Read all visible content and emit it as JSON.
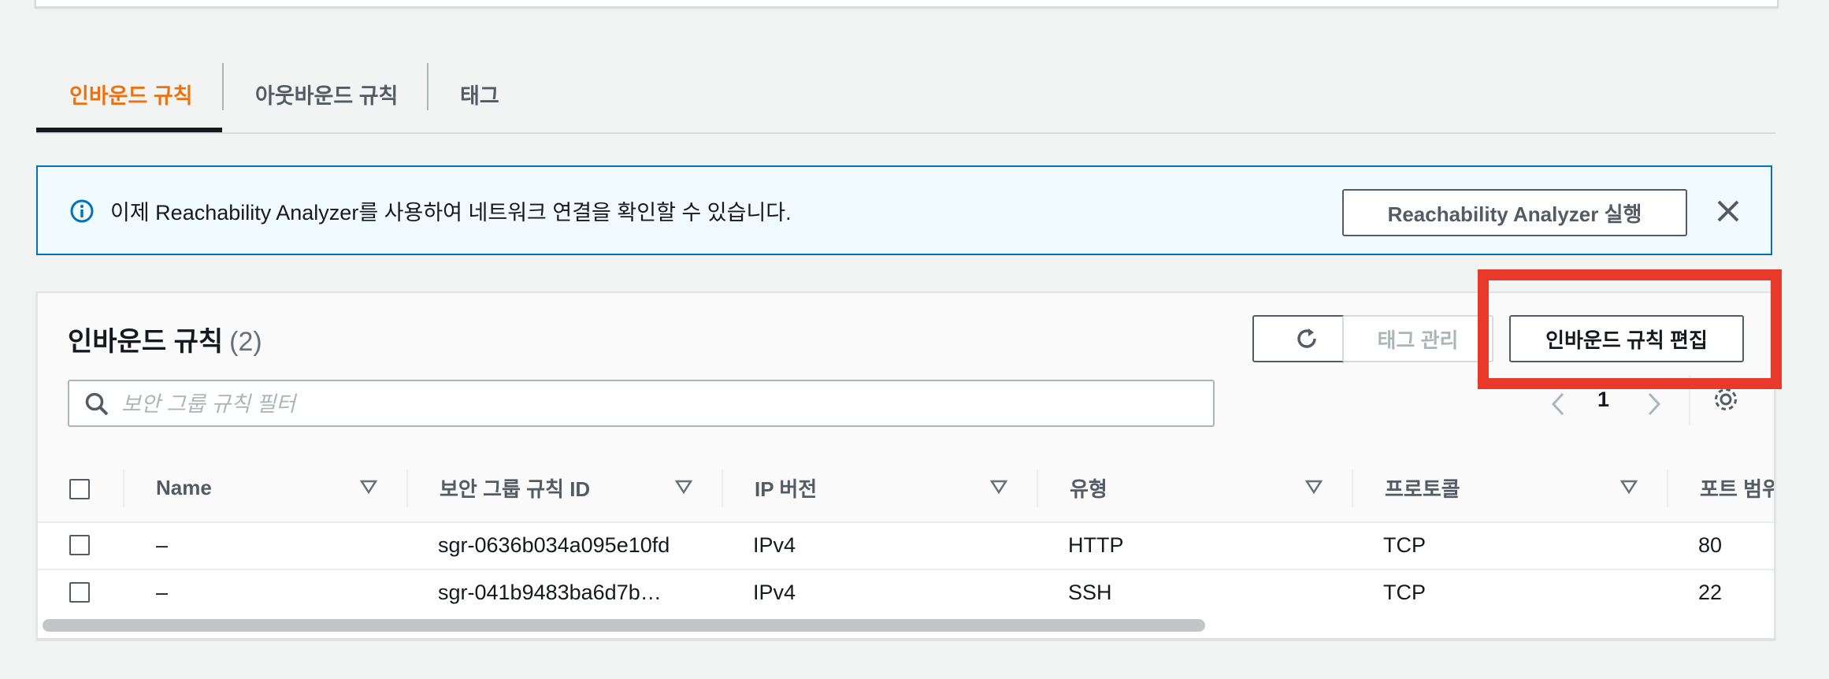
{
  "tabs": [
    {
      "label": "인바운드 규칙",
      "active": true
    },
    {
      "label": "아웃바운드 규칙",
      "active": false
    },
    {
      "label": "태그",
      "active": false
    }
  ],
  "alert": {
    "message": "이제 Reachability Analyzer를 사용하여 네트워크 연결을 확인할 수 있습니다.",
    "button_label": "Reachability Analyzer 실행",
    "icon": "info-icon"
  },
  "panel": {
    "title": "인바운드 규칙",
    "count": "(2)",
    "tag_button_label": "태그 관리",
    "edit_button_label": "인바운드 규칙 편집",
    "search_placeholder": "보안 그룹 규칙 필터",
    "page_number": "1"
  },
  "table": {
    "columns": [
      "Name",
      "보안 그룹 규칙 ID",
      "IP 버전",
      "유형",
      "프로토콜",
      "포트 범위"
    ],
    "rows": [
      {
        "name": "–",
        "rule_id": "sgr-0636b034a095e10fd",
        "ip_version": "IPv4",
        "type": "HTTP",
        "protocol": "TCP",
        "port": "80"
      },
      {
        "name": "–",
        "rule_id": "sgr-041b9483ba6d7b…",
        "ip_version": "IPv4",
        "type": "SSH",
        "protocol": "TCP",
        "port": "22"
      }
    ]
  },
  "colors": {
    "active_tab": "#ec7211",
    "alert_border": "#0073bb",
    "alert_background": "#f1faff",
    "highlight": "#e8392a"
  }
}
